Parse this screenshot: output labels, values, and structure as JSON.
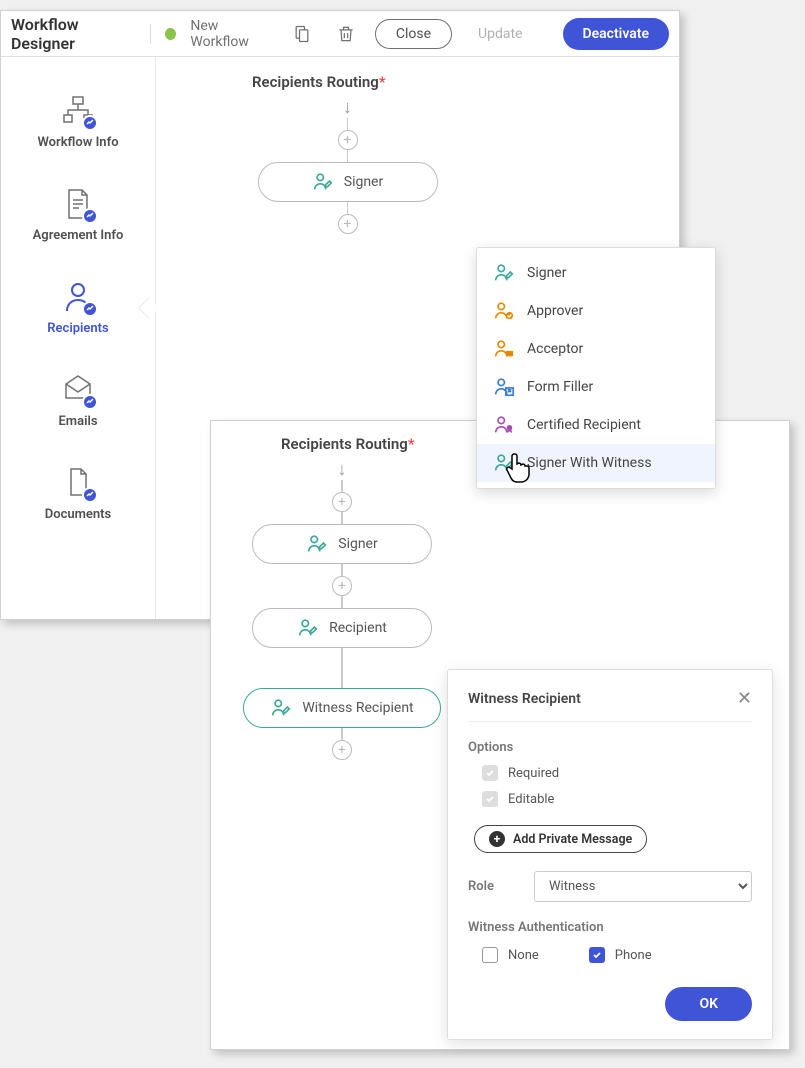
{
  "toolbar": {
    "title": "Workflow Designer",
    "status_label": "New Workflow",
    "close_label": "Close",
    "update_label": "Update",
    "deactivate_label": "Deactivate"
  },
  "sidebar": {
    "items": [
      {
        "label": "Workflow Info"
      },
      {
        "label": "Agreement Info"
      },
      {
        "label": "Recipients"
      },
      {
        "label": "Emails"
      },
      {
        "label": "Documents"
      }
    ]
  },
  "flow1": {
    "section_title": "Recipients Routing",
    "node1_label": "Signer"
  },
  "dropdown": {
    "items": [
      {
        "label": "Signer",
        "color": "#3aa89b"
      },
      {
        "label": "Approver",
        "color": "#e38b00"
      },
      {
        "label": "Acceptor",
        "color": "#e38b00"
      },
      {
        "label": "Form Filler",
        "color": "#3a7bd5"
      },
      {
        "label": "Certified Recipient",
        "color": "#a64db3"
      },
      {
        "label": "Signer With Witness",
        "color": "#3aa89b"
      }
    ]
  },
  "flow2": {
    "section_title": "Recipients Routing",
    "node1_label": "Signer",
    "node2_label": "Recipient",
    "node3_label": "Witness Recipient"
  },
  "panel": {
    "title": "Witness Recipient",
    "options_label": "Options",
    "required_label": "Required",
    "editable_label": "Editable",
    "add_msg_label": "Add Private Message",
    "role_label": "Role",
    "role_value": "Witness",
    "auth_label": "Witness Authentication",
    "none_label": "None",
    "phone_label": "Phone",
    "ok_label": "OK"
  }
}
